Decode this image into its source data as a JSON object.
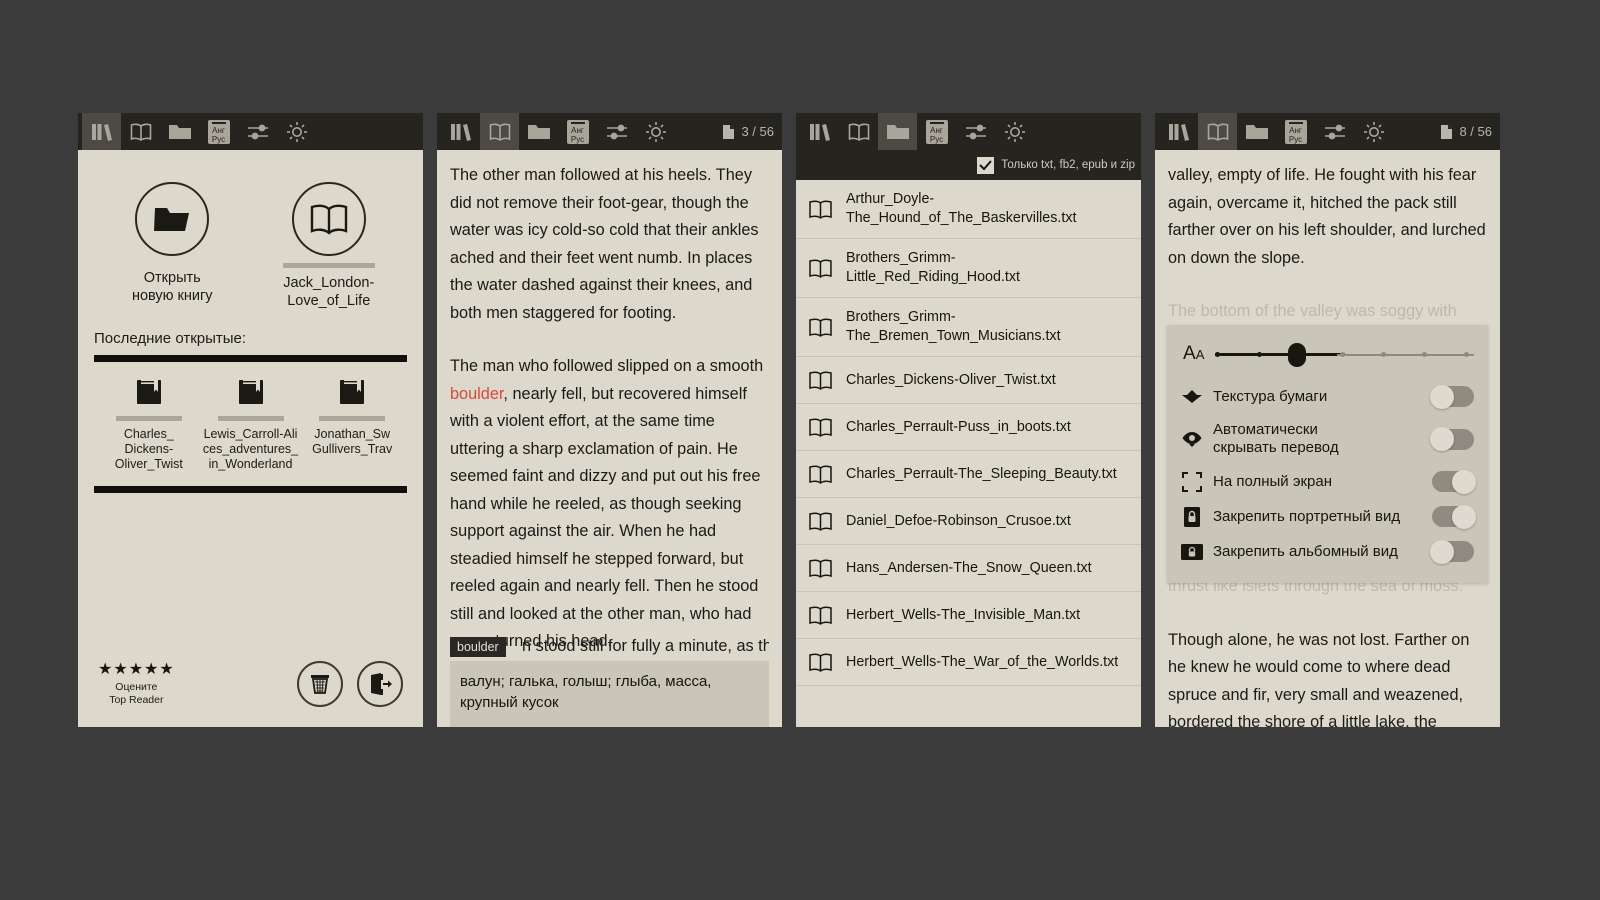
{
  "background_color": "#3b3b3b",
  "panel_bg": "#dcd8cb",
  "toolbar_bg": "#26241f",
  "accent_highlight": "#d9483f",
  "toolbar": {
    "items": [
      {
        "name": "library-icon",
        "label": "Библиотека"
      },
      {
        "name": "book-open-icon",
        "label": "Читалка"
      },
      {
        "name": "folder-icon",
        "label": "Папки"
      },
      {
        "name": "translate-icon",
        "label": "Анг Рус"
      },
      {
        "name": "sliders-icon",
        "label": "Настройки"
      },
      {
        "name": "brightness-icon",
        "label": "Яркость"
      }
    ],
    "lang_top": "Анг",
    "lang_bottom": "Рус"
  },
  "panel1": {
    "active_tab_index": 0,
    "open_book": {
      "icon": "folder-icon",
      "caption_line1": "Открыть",
      "caption_line2": "новую книгу"
    },
    "current_book": {
      "icon": "book-open-icon",
      "caption_line1": "Jack_London-",
      "caption_line2": "Love_of_Life"
    },
    "recent_title": "Последние открытые:",
    "recent": [
      {
        "icon": "book-closed-icon",
        "name": "Charles_\nDickens-\nOliver_Twist"
      },
      {
        "icon": "book-closed-icon",
        "name": "Lewis_Carroll-Ali\nces_adventures_\nin_Wonderland"
      },
      {
        "icon": "book-closed-icon",
        "name": "Jonathan_Sw\nGullivers_Trav"
      }
    ],
    "rating": {
      "stars": "★★★★★",
      "line1": "Оцените",
      "line2": "Top Reader"
    },
    "footer_buttons": [
      {
        "name": "trash-button",
        "icon": "trash-icon"
      },
      {
        "name": "exit-button",
        "icon": "exit-icon"
      }
    ]
  },
  "panel2": {
    "active_tab_index": 1,
    "page_counter": "3 / 56",
    "paragraph1": "The other man followed at his heels. They did not remove their foot-gear, though the water was icy cold-so cold that their ankles ached and their feet went numb. In places the water dashed against their knees, and both men staggered for footing.",
    "paragraph2_before": "The man who followed slipped on a smooth ",
    "paragraph2_highlight": "boulder",
    "paragraph2_after": ", nearly fell, but recovered himself with a violent effort, at the same time uttering a sharp exclamation of pain. He seemed faint and dizzy and put out his free hand while he reeled, as though seeking support against the air. When he had steadied himself he stepped forward, but reeled again and nearly fell. Then he stood still and looked at the other man, who had never turned his head.",
    "paragraph3_partial": "n stood still for fully a minute, as though",
    "translation": {
      "word_chip": "boulder",
      "definition_line1": "валун; галька, голыш; глыба, масса,",
      "definition_line2": "крупный кусок"
    }
  },
  "panel3": {
    "active_tab_index": 2,
    "filter": {
      "checked": true,
      "label": "Только txt, fb2, epub и zip"
    },
    "files": [
      "Arthur_Doyle-\nThe_Hound_of_The_Baskervilles.txt",
      "Brothers_Grimm-Little_Red_Riding_Hood.txt",
      "Brothers_Grimm-\nThe_Bremen_Town_Musicians.txt",
      "Charles_Dickens-Oliver_Twist.txt",
      "Charles_Perrault-Puss_in_boots.txt",
      "Charles_Perrault-The_Sleeping_Beauty.txt",
      "Daniel_Defoe-Robinson_Crusoe.txt",
      "Hans_Andersen-The_Snow_Queen.txt",
      "Herbert_Wells-The_Invisible_Man.txt",
      "Herbert_Wells-The_War_of_the_Worlds.txt"
    ]
  },
  "panel4": {
    "active_tab_index": 1,
    "page_counter": "8 / 56",
    "paragraph_top": "valley, empty of life. He fought with his fear again, overcame it, hitched the pack still farther over on his left shoulder, and lurched on down the slope.",
    "paragraph_behind": "The bottom of the valley was soggy with water, which the thick moss held, spongelike, close to the surface. This water squirted out from under his feet at every step, and each time he lifted a foot the action culminated in a sucking sound as the wet moss reluctantly released its grip. He picked his way from muskeg to muskeg, and followed the other man's footsteps along and across the rocky ledges which thrust like islets through the sea of moss.",
    "paragraph_bottom": "Though alone, he was not lost. Farther on he knew he would come to where dead spruce and fir, very small and weazened, bordered the shore of a little lake, the titchin-nichilie, in the tongue",
    "settings": {
      "font_size_slider": {
        "name": "font-size-slider",
        "icon_label": "Aa",
        "value_index": 2,
        "tick_count": 7
      },
      "rows": [
        {
          "icon": "paper-boat-icon",
          "label": "Текстура бумаги",
          "state": "off"
        },
        {
          "icon": "eye-icon",
          "label": "Автоматически\nскрывать перевод",
          "state": "off"
        },
        {
          "icon": "fullscreen-icon",
          "label": "На полный экран",
          "state": "on"
        },
        {
          "icon": "lock-portrait-icon",
          "label": "Закрепить портретный вид",
          "state": "on"
        },
        {
          "icon": "lock-landscape-icon",
          "label": "Закрепить альбомный вид",
          "state": "off"
        }
      ]
    }
  }
}
